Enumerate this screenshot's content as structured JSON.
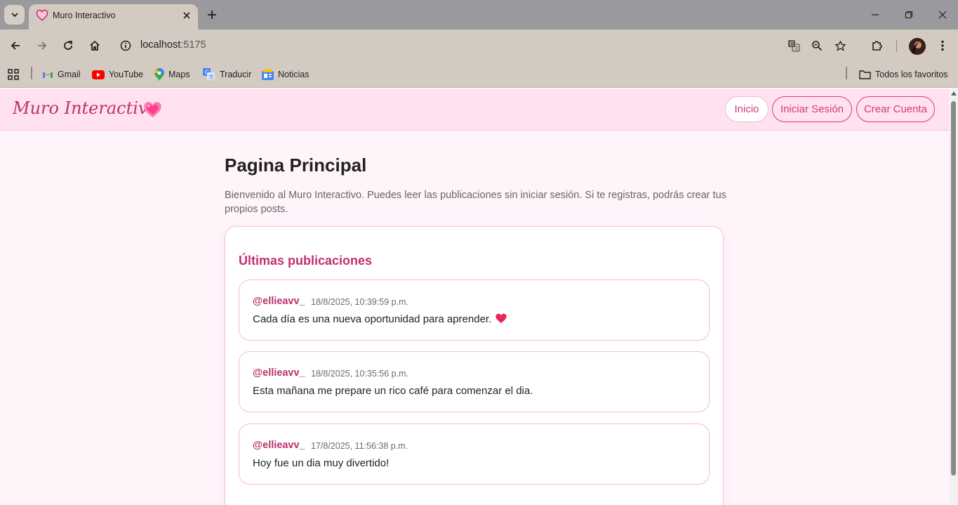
{
  "browser": {
    "tab_title": "Muro Interactivo",
    "url_host": "localhost",
    "url_port": ":5175",
    "bookmarks": [
      {
        "label": "Gmail",
        "icon": "gmail-icon"
      },
      {
        "label": "YouTube",
        "icon": "youtube-icon"
      },
      {
        "label": "Maps",
        "icon": "maps-icon"
      },
      {
        "label": "Traducir",
        "icon": "translate-icon"
      },
      {
        "label": "Noticias",
        "icon": "news-icon"
      }
    ],
    "all_bookmarks": "Todos los favoritos"
  },
  "nav": {
    "brand": "Muro Interactivo",
    "brand_icon": "sparkling-heart-icon",
    "links": [
      "Inicio",
      "Iniciar Sesión",
      "Crear Cuenta"
    ],
    "active": "Inicio"
  },
  "page": {
    "title": "Pagina Principal",
    "intro": "Bienvenido al Muro Interactivo. Puedes leer las publicaciones sin iniciar sesión. Si te registras, podrás crear tus propios posts.",
    "feed_title": "Últimas publicaciones"
  },
  "posts": [
    {
      "user": "@ellieavv_",
      "date": "18/8/2025, 10:39:59 p.m.",
      "text": "Cada día es una nueva oportunidad para aprender.",
      "emoji": "heart-icon"
    },
    {
      "user": "@ellieavv_",
      "date": "18/8/2025, 10:35:56 p.m.",
      "text": "Esta mañana me prepare un rico café para comenzar el dia."
    },
    {
      "user": "@ellieavv_",
      "date": "17/8/2025, 11:56:38 p.m.",
      "text": "Hoy fue un dia muy divertido!"
    }
  ],
  "colors": {
    "accent": "#cf3d7c",
    "navbar_bg": "#ffe1ef",
    "page_bg": "#fff4fa"
  }
}
